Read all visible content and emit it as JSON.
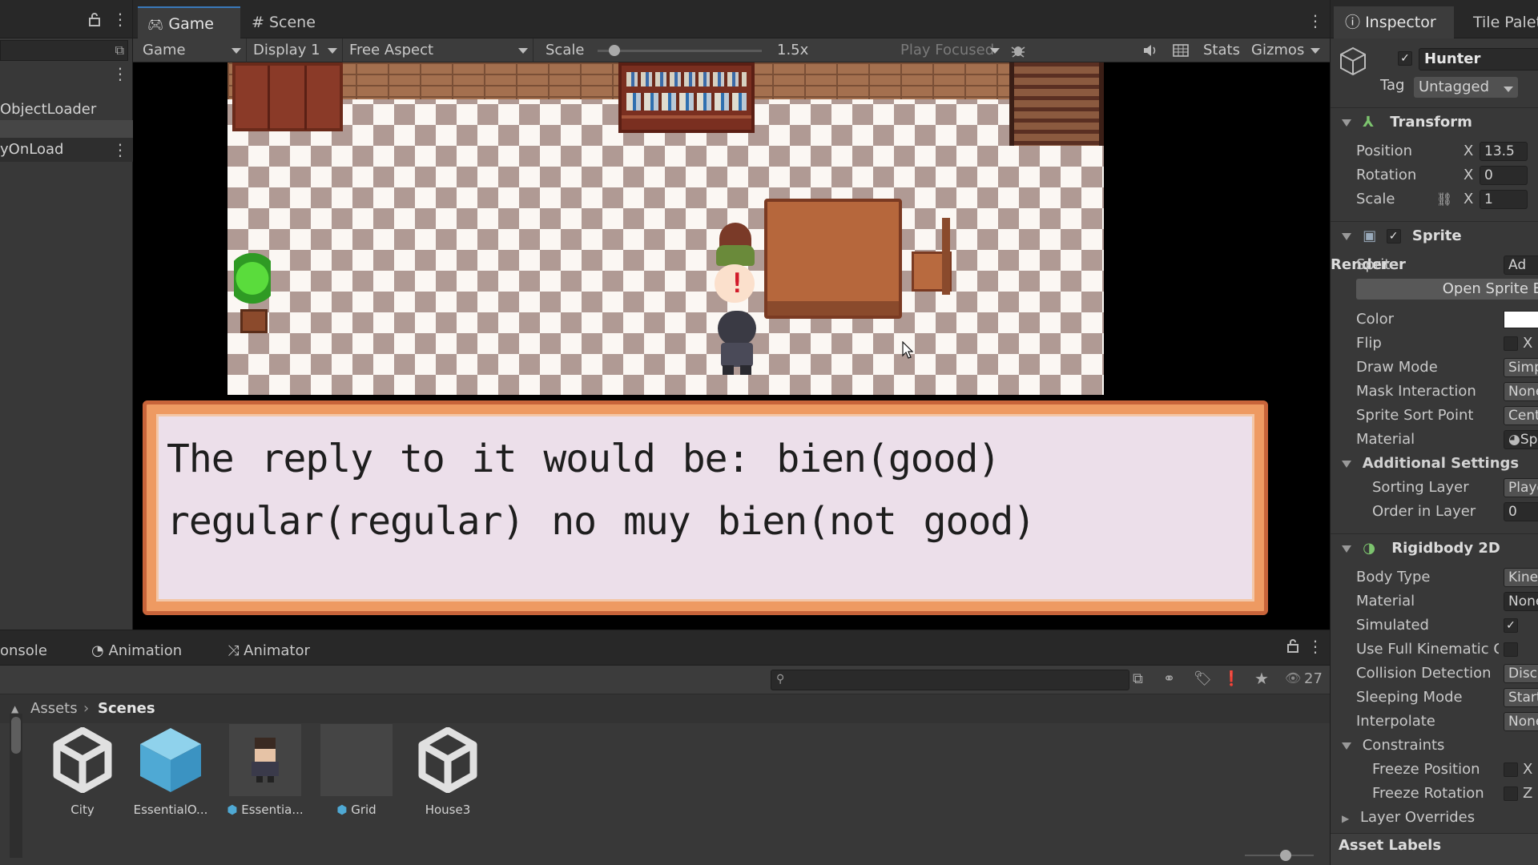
{
  "hierarchy": {
    "items": [
      "ObjectLoader",
      "yOnLoad"
    ]
  },
  "game_view": {
    "tabs": [
      "Game",
      "Scene"
    ],
    "toolbar": {
      "mode": "Game",
      "display": "Display 1",
      "aspect": "Free Aspect",
      "scale_label": "Scale",
      "scale_value": "1.5x",
      "play_focused": "Play Focused",
      "stats": "Stats",
      "gizmos": "Gizmos"
    },
    "dialog_text": "The reply to it would be: bien(good)  regular(regular)  no muy bien(not good)"
  },
  "bottom_panel": {
    "tabs": [
      "onsole",
      "Animation",
      "Animator"
    ],
    "search_placeholder": "",
    "hidden_count": "27",
    "breadcrumb": [
      "Assets",
      "Scenes"
    ],
    "assets": [
      {
        "name": "City",
        "icon": "unity-scene-icon"
      },
      {
        "name": "EssentialO...",
        "icon": "prefab-cube-icon"
      },
      {
        "name": "Essentia...",
        "icon": "character-sprite-icon"
      },
      {
        "name": "Grid",
        "icon": "grid-prefab-icon"
      },
      {
        "name": "House3",
        "icon": "unity-scene-icon"
      }
    ]
  },
  "inspector": {
    "tabs": [
      "Inspector",
      "Tile Palett"
    ],
    "object_name": "Hunter",
    "tag_label": "Tag",
    "tag_value": "Untagged",
    "transform": {
      "title": "Transform",
      "position_label": "Position",
      "position_x": "13.5",
      "rotation_label": "Rotation",
      "rotation_x": "0",
      "scale_label": "Scale",
      "scale_x": "1",
      "axis_x": "X"
    },
    "sprite_renderer": {
      "title": "Sprite Renderer",
      "sprite_label": "Sprite",
      "sprite_value": "Ad",
      "open_sprite_button": "Open Sprite E",
      "color_label": "Color",
      "flip_label": "Flip",
      "flip_x": "X",
      "draw_mode_label": "Draw Mode",
      "draw_mode_value": "Simp",
      "mask_label": "Mask Interaction",
      "mask_value": "None",
      "sort_point_label": "Sprite Sort Point",
      "sort_point_value": "Cent",
      "material_label": "Material",
      "material_value": "Sp",
      "additional_settings": "Additional Settings",
      "sorting_layer_label": "Sorting Layer",
      "sorting_layer_value": "Playe",
      "order_label": "Order in Layer",
      "order_value": "0"
    },
    "rigidbody": {
      "title": "Rigidbody 2D",
      "body_type_label": "Body Type",
      "body_type_value": "Kinem",
      "material_label": "Material",
      "material_value": "None",
      "simulated_label": "Simulated",
      "full_kinematic_label": "Use Full Kinematic Co",
      "collision_label": "Collision Detection",
      "collision_value": "Discr",
      "sleeping_label": "Sleeping Mode",
      "sleeping_value": "Start",
      "interpolate_label": "Interpolate",
      "interpolate_value": "None",
      "constraints_label": "Constraints",
      "freeze_position_label": "Freeze Position",
      "freeze_position_axis": "X",
      "freeze_rotation_label": "Freeze Rotation",
      "freeze_rotation_axis": "Z",
      "layer_overrides_label": "Layer Overrides"
    },
    "asset_labels": "Asset Labels"
  }
}
